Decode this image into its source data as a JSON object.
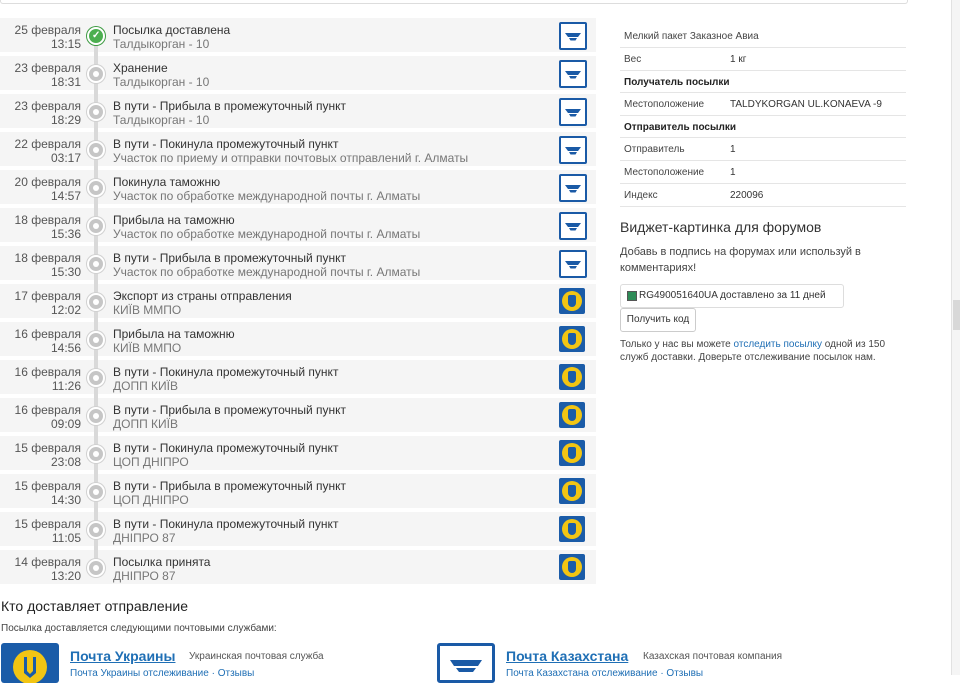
{
  "timeline": [
    {
      "date": "25 февраля",
      "time": "13:15",
      "status": "Посылка доставлена",
      "place": "Талдыкорган - 10",
      "carrier": "kz",
      "done": true
    },
    {
      "date": "23 февраля",
      "time": "18:31",
      "status": "Хранение",
      "place": "Талдыкорган - 10",
      "carrier": "kz",
      "done": false
    },
    {
      "date": "23 февраля",
      "time": "18:29",
      "status": "В пути - Прибыла в промежуточный пункт",
      "place": "Талдыкорган - 10",
      "carrier": "kz",
      "done": false
    },
    {
      "date": "22 февраля",
      "time": "03:17",
      "status": "В пути - Покинула промежуточный пункт",
      "place": "Участок по приему и отправки почтовых отправлений г. Алматы",
      "carrier": "kz",
      "done": false
    },
    {
      "date": "20 февраля",
      "time": "14:57",
      "status": "Покинула таможню",
      "place": "Участок по обработке международной почты г. Алматы",
      "carrier": "kz",
      "done": false
    },
    {
      "date": "18 февраля",
      "time": "15:36",
      "status": "Прибыла на таможню",
      "place": "Участок по обработке международной почты г. Алматы",
      "carrier": "kz",
      "done": false
    },
    {
      "date": "18 февраля",
      "time": "15:30",
      "status": "В пути - Прибыла в промежуточный пункт",
      "place": "Участок по обработке международной почты г. Алматы",
      "carrier": "kz",
      "done": false
    },
    {
      "date": "17 февраля",
      "time": "12:02",
      "status": "Экспорт из страны отправления",
      "place": "КИЇВ ММПО",
      "carrier": "ua",
      "done": false
    },
    {
      "date": "16 февраля",
      "time": "14:56",
      "status": "Прибыла на таможню",
      "place": "КИЇВ ММПО",
      "carrier": "ua",
      "done": false
    },
    {
      "date": "16 февраля",
      "time": "11:26",
      "status": "В пути - Покинула промежуточный пункт",
      "place": "ДОПП КИЇВ",
      "carrier": "ua",
      "done": false
    },
    {
      "date": "16 февраля",
      "time": "09:09",
      "status": "В пути - Прибыла в промежуточный пункт",
      "place": "ДОПП КИЇВ",
      "carrier": "ua",
      "done": false
    },
    {
      "date": "15 февраля",
      "time": "23:08",
      "status": "В пути - Покинула промежуточный пункт",
      "place": "ЦОП ДНІПРО",
      "carrier": "ua",
      "done": false
    },
    {
      "date": "15 февраля",
      "time": "14:30",
      "status": "В пути - Прибыла в промежуточный пункт",
      "place": "ЦОП ДНІПРО",
      "carrier": "ua",
      "done": false
    },
    {
      "date": "15 февраля",
      "time": "11:05",
      "status": "В пути - Покинула промежуточный пункт",
      "place": "ДНІПРО 87",
      "carrier": "ua",
      "done": false
    },
    {
      "date": "14 февраля",
      "time": "13:20",
      "status": "Посылка принята",
      "place": "ДНІПРО 87",
      "carrier": "ua",
      "done": false
    }
  ],
  "info": {
    "package_type": "Мелкий пакет Заказное Авиа",
    "weight_label": "Вес",
    "weight_value": "1 кг",
    "recipient_header": "Получатель посылки",
    "recipient_location_label": "Местоположение",
    "recipient_location_value": "TALDYKORGAN UL.KONAEVA -9",
    "sender_header": "Отправитель посылки",
    "sender_label": "Отправитель",
    "sender_value": "1",
    "sender_location_label": "Местоположение",
    "sender_location_value": "1",
    "index_label": "Индекс",
    "index_value": "220096"
  },
  "widget": {
    "title": "Виджет-картинка для форумов",
    "description": "Добавь в подпись на форумах или используй в комментариях!",
    "preview_text": "RG490051640UA доставлено за 11 дней",
    "get_code_label": "Получить код",
    "note_before": "Только у нас вы можете ",
    "note_link": "отследить посылку",
    "note_after": " одной из 150 служб доставки. Доверьте отслеживание посылок нам."
  },
  "carriers_section": {
    "title": "Кто доставляет отправление",
    "description": "Посылка доставляется следующими почтовыми службами:",
    "ukraine": {
      "name": "Почта Украины",
      "desc": "Украинская почтовая служба",
      "links": "Почта Украины отслеживание · Отзывы"
    },
    "kazakhstan": {
      "name": "Почта Казахстана",
      "desc": "Казахская почтовая компания",
      "links": "Почта Казахстана отслеживание · Отзывы"
    }
  },
  "colors": {
    "accent": "#1f6fb5",
    "done_green": "#4caf50",
    "kz_blue": "#1a5aa6",
    "ua_yellow": "#f2c513"
  }
}
